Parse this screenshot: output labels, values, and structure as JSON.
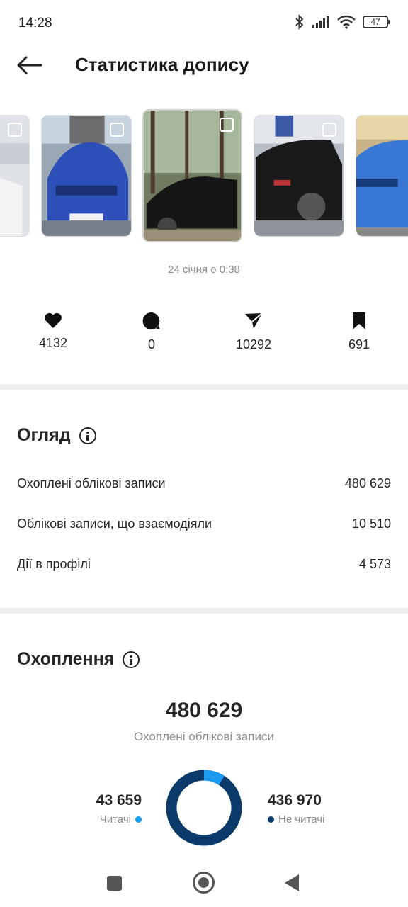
{
  "status_bar": {
    "time": "14:28",
    "battery": "47"
  },
  "header": {
    "title": "Статистика допису"
  },
  "post": {
    "date": "24 січня о 0:38"
  },
  "stats": {
    "likes": "4132",
    "comments": "0",
    "shares": "10292",
    "saves": "691"
  },
  "overview": {
    "title": "Огляд",
    "rows": [
      {
        "label": "Охоплені облікові записи",
        "value": "480 629"
      },
      {
        "label": "Облікові записи, що взаємодіяли",
        "value": "10 510"
      },
      {
        "label": "Дії в профілі",
        "value": "4 573"
      }
    ]
  },
  "reach": {
    "title": "Охоплення",
    "total": "480 629",
    "subtitle": "Охоплені облікові записи",
    "followers_value": "43 659",
    "followers_label": "Читачі",
    "non_followers_value": "436 970",
    "non_followers_label": "Не читачі",
    "followers_fraction": 0.0908,
    "colors": {
      "followers": "#1d9bf0",
      "non_followers": "#0c3a6b"
    }
  },
  "thumbnails": [
    {
      "name": "thumb-white-car",
      "color": "#e8e8ea"
    },
    {
      "name": "thumb-blue-bmw",
      "color": "#2c4fb8"
    },
    {
      "name": "thumb-black-sedan",
      "color": "#3f4a3a"
    },
    {
      "name": "thumb-black-suv",
      "color": "#2a2a2a"
    },
    {
      "name": "thumb-blue-skoda",
      "color": "#3a78d6"
    }
  ]
}
